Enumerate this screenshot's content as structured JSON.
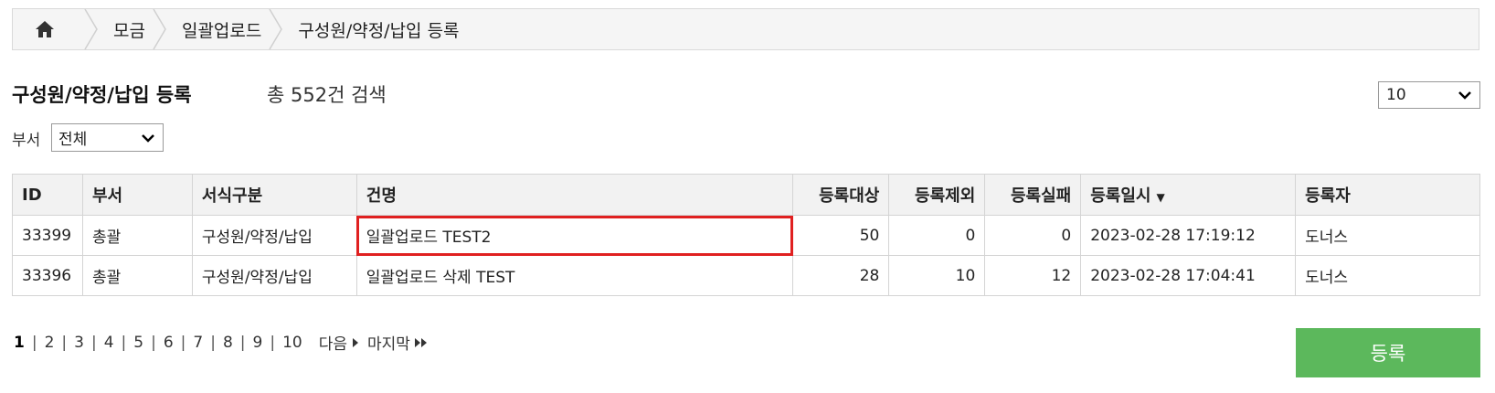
{
  "breadcrumb": {
    "home_icon": "home-icon",
    "items": [
      "모금",
      "일괄업로드",
      "구성원/약정/납입 등록"
    ]
  },
  "header": {
    "title": "구성원/약정/납입 등록",
    "total_text": "총 552건 검색",
    "page_size": "10"
  },
  "filter": {
    "dept_label": "부서",
    "dept_value": "전체"
  },
  "table": {
    "columns": [
      "ID",
      "부서",
      "서식구분",
      "건명",
      "등록대상",
      "등록제외",
      "등록실패",
      "등록일시",
      "등록자"
    ],
    "sort_indicator": "▼",
    "rows": [
      {
        "id": "33399",
        "dept": "총괄",
        "form": "구성원/약정/납입",
        "name": "일괄업로드 TEST2",
        "target": "50",
        "excluded": "0",
        "failed": "0",
        "date": "2023-02-28 17:19:12",
        "registrant": "도너스"
      },
      {
        "id": "33396",
        "dept": "총괄",
        "form": "구성원/약정/납입",
        "name": "일괄업로드 삭제 TEST",
        "target": "28",
        "excluded": "10",
        "failed": "12",
        "date": "2023-02-28 17:04:41",
        "registrant": "도너스"
      }
    ]
  },
  "pagination": {
    "pages": [
      "1",
      "2",
      "3",
      "4",
      "5",
      "6",
      "7",
      "8",
      "9",
      "10"
    ],
    "current": "1",
    "next_label": "다음",
    "last_label": "마지막"
  },
  "register_button": "등록",
  "colors": {
    "highlight": "#e02020",
    "register_button": "#5cb85c"
  }
}
